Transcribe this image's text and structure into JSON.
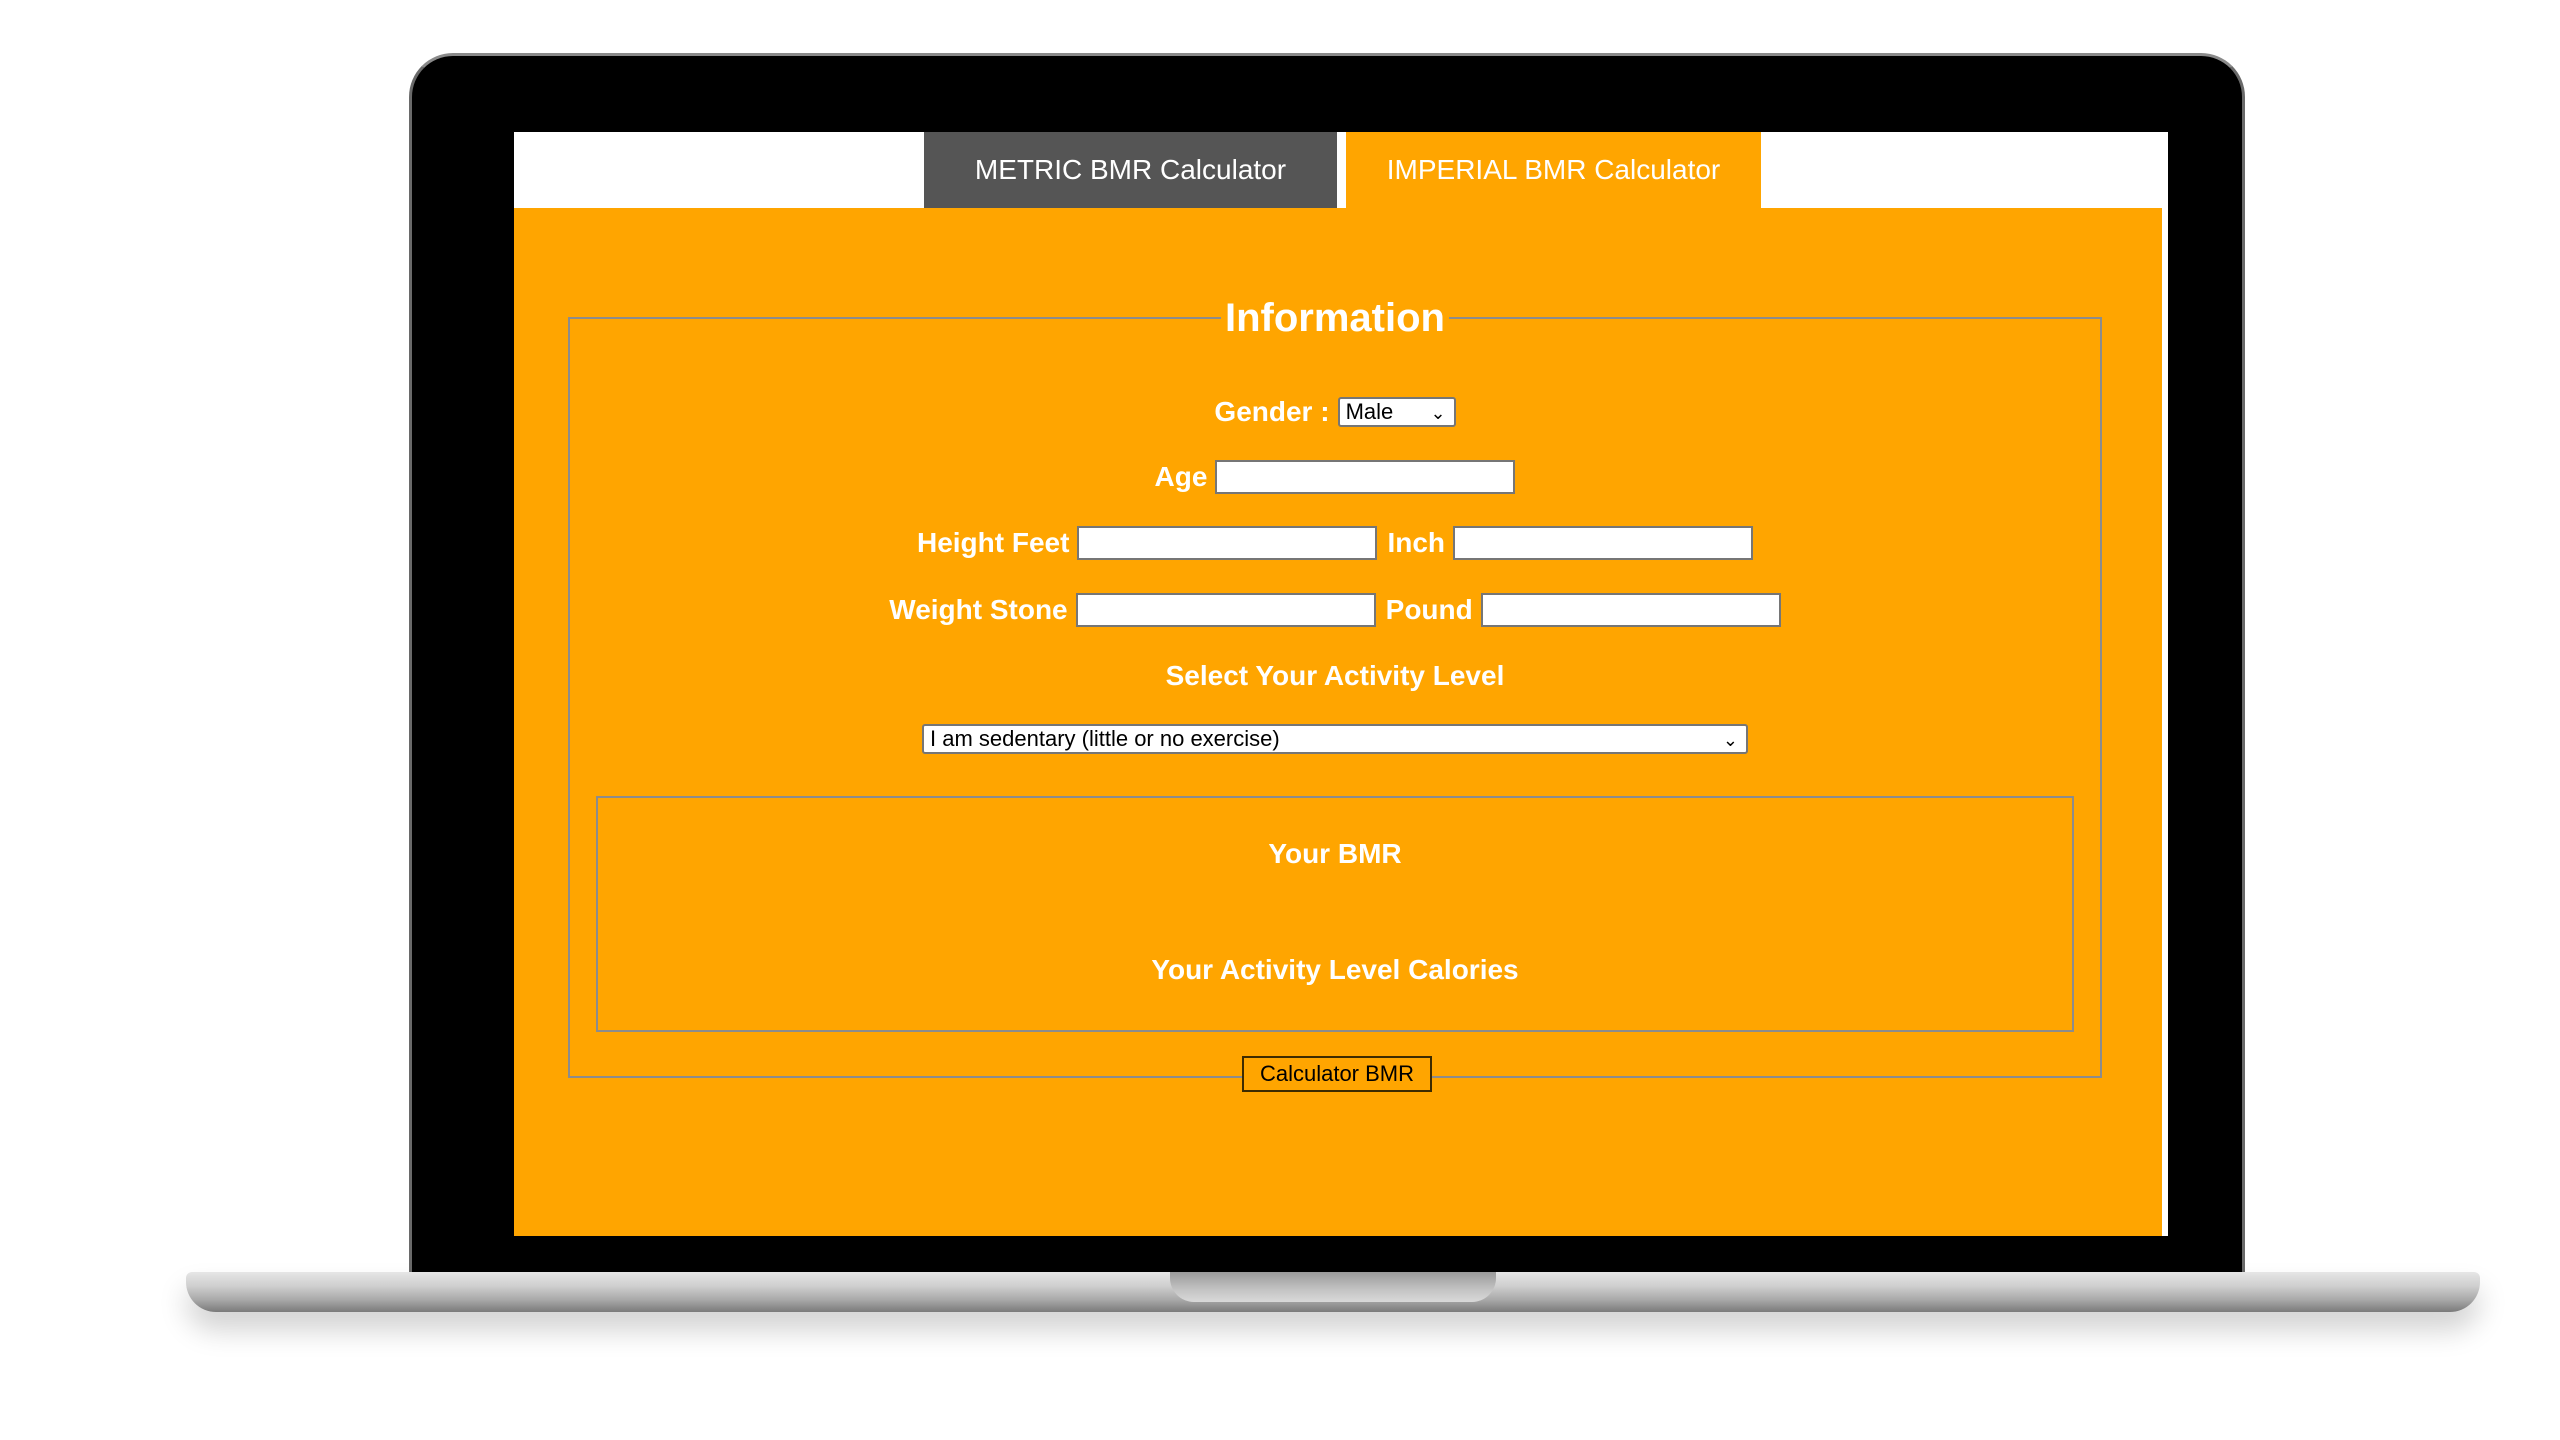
{
  "tabs": {
    "metric_label": "METRIC BMR Calculator",
    "imperial_label": "IMPERIAL BMR Calculator"
  },
  "form": {
    "legend": "Information",
    "gender_label": "Gender :",
    "gender_value": "Male",
    "age_label": "Age",
    "age_value": "",
    "height_feet_label": "Height Feet",
    "height_feet_value": "",
    "inch_label": "Inch",
    "inch_value": "",
    "weight_stone_label": "Weight Stone",
    "weight_stone_value": "",
    "pound_label": "Pound",
    "pound_value": "",
    "activity_heading": "Select Your Activity Level",
    "activity_value": "I am sedentary (little or no exercise)"
  },
  "results": {
    "bmr_label": "Your BMR",
    "calories_label": "Your Activity Level Calories"
  },
  "actions": {
    "calculate_label": "Calculator BMR"
  },
  "colors": {
    "accent": "#ffa500",
    "inactive_tab": "#555555",
    "text_on_accent": "#ffffff"
  },
  "icons": {
    "select_arrow": "chevron-down-icon"
  }
}
